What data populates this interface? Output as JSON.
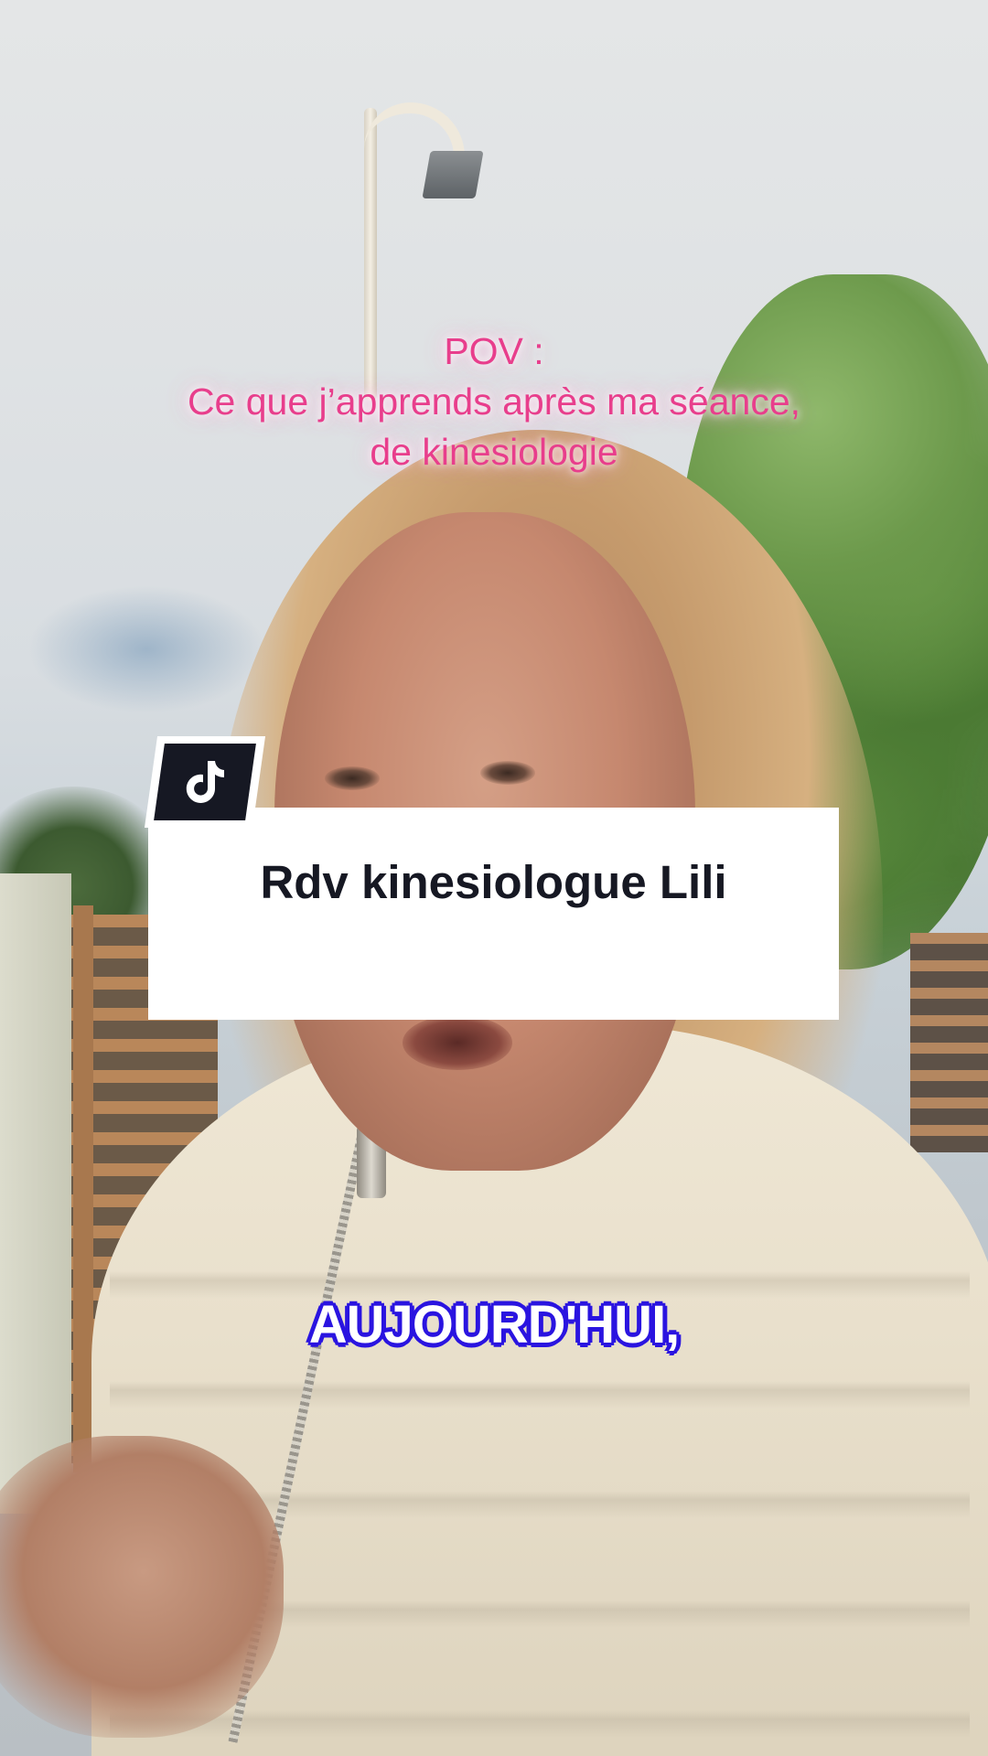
{
  "pov_title": {
    "line1": "POV :",
    "line2": "Ce que j’apprends après ma séance,",
    "line3": "de kinesiologie",
    "color": "#e83e8c"
  },
  "card": {
    "title": "Rdv kinesiologue Lili",
    "badge_icon": "tiktok-logo-icon",
    "background": "#ffffff",
    "text_color": "#161823"
  },
  "caption": {
    "text": "AUJOURD'HUI,",
    "fill_color": "#ffffff",
    "outline_color": "#2a14e0"
  }
}
